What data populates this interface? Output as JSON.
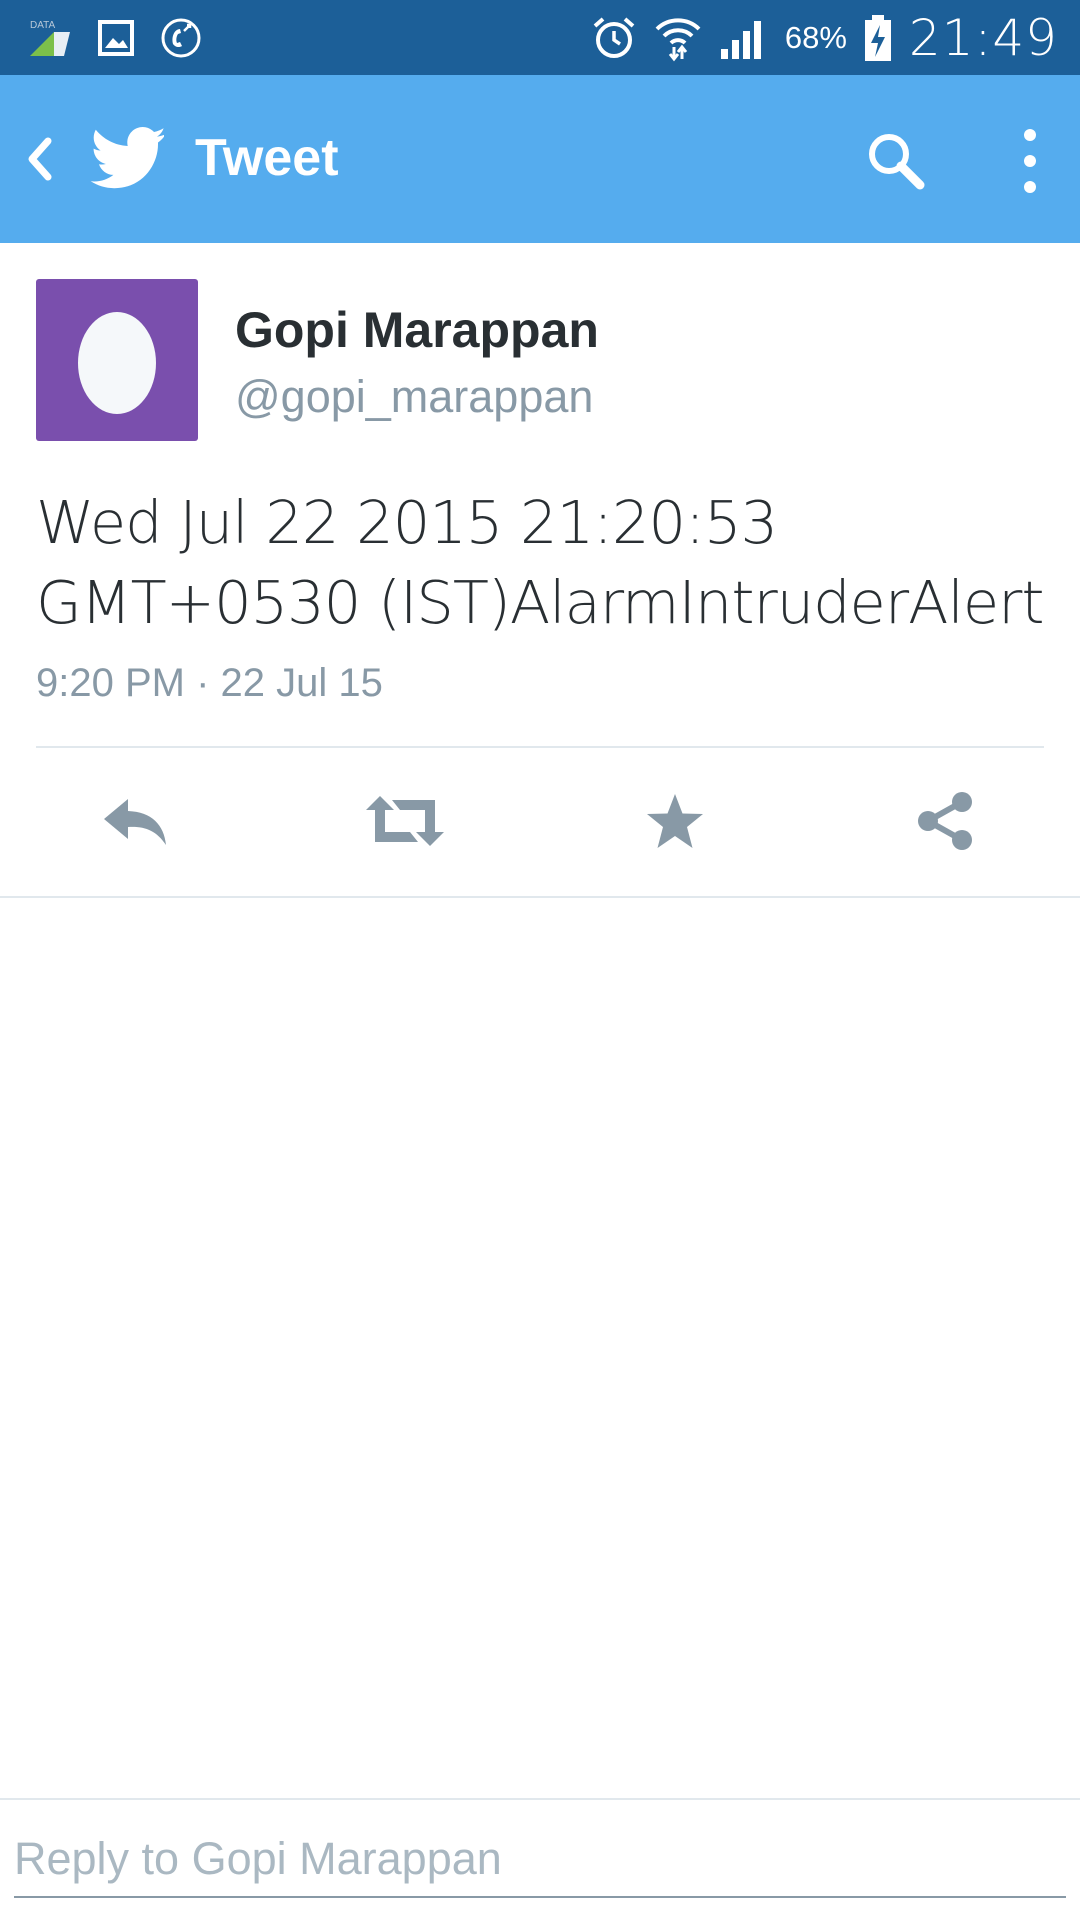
{
  "status_bar": {
    "data_label": "DATA",
    "battery_percent": "68%",
    "time": "21:49",
    "icons": [
      "data-signal-icon",
      "image-icon",
      "call-icon",
      "alarm-icon",
      "wifi-icon",
      "cell-signal-icon",
      "battery-charging-icon"
    ]
  },
  "app_bar": {
    "title": "Tweet",
    "icons": [
      "back-icon",
      "twitter-bird-icon",
      "search-icon",
      "overflow-menu-icon"
    ]
  },
  "tweet": {
    "display_name": "Gopi Marappan",
    "handle": "@gopi_marappan",
    "text": "Wed Jul 22 2015 21:20:53 GMT+0530 (IST)AlarmIntruderAlert",
    "timestamp": "9:20 PM · 22 Jul 15",
    "actions": [
      "reply-icon",
      "retweet-icon",
      "favorite-icon",
      "share-icon"
    ]
  },
  "reply": {
    "placeholder": "Reply to Gopi Marappan"
  },
  "colors": {
    "status_bar": "#1c5f98",
    "app_bar": "#55acee",
    "avatar": "#7a4fad",
    "text_primary": "#292f33",
    "text_secondary": "#8899a6",
    "icon_gray": "#8899a6"
  }
}
